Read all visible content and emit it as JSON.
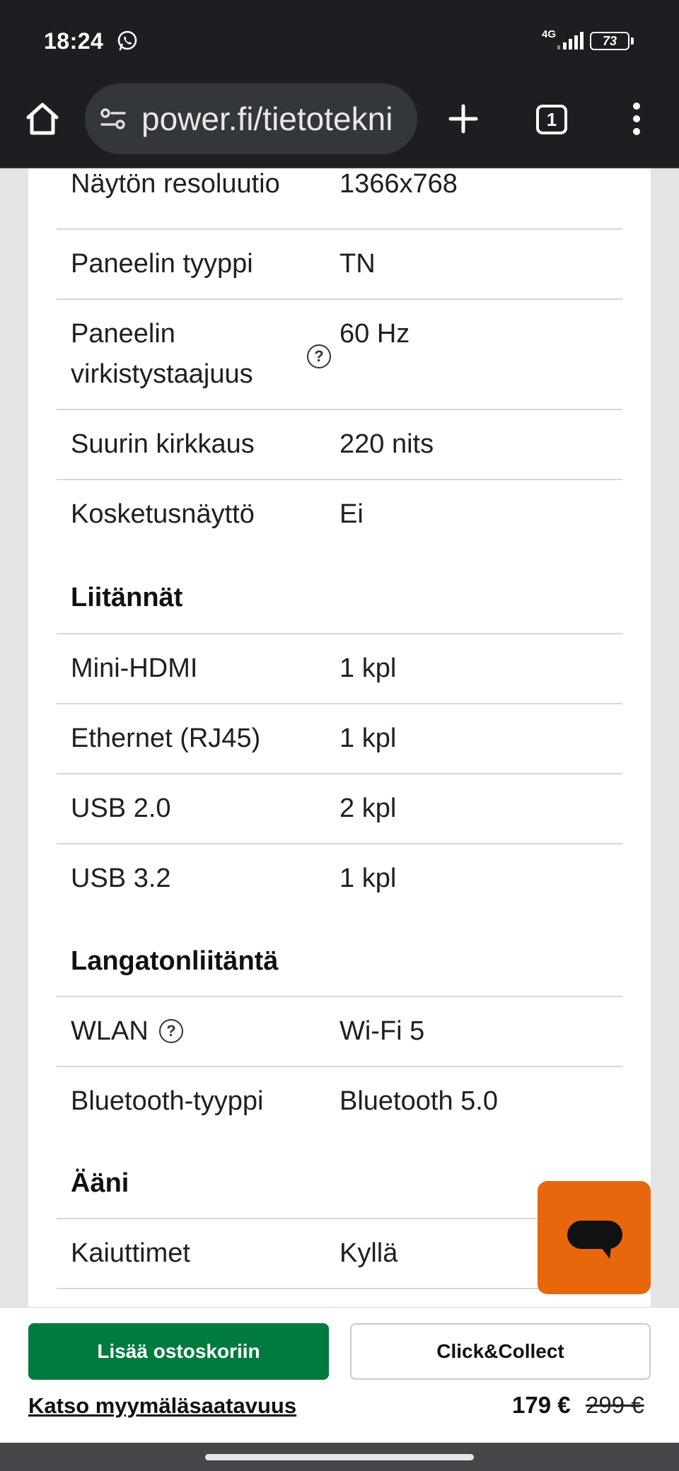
{
  "status_bar": {
    "time": "18:24",
    "network": "4G",
    "battery": "73",
    "icons": [
      "whatsapp-icon",
      "signal-icon",
      "battery-icon"
    ]
  },
  "browser": {
    "url": "power.fi/tietotekni",
    "tab_count": "1",
    "icons": [
      "home-icon",
      "site-settings-icon",
      "new-tab-icon",
      "tab-switcher-icon",
      "overflow-menu-icon"
    ]
  },
  "specs": {
    "display": [
      {
        "label": "Näytön resoluutio",
        "value": "1366x768"
      },
      {
        "label": "Paneelin tyyppi",
        "value": "TN"
      },
      {
        "label_line1": "Paneelin",
        "label_line2": "virkistystaajuus",
        "value": "60 Hz",
        "help": "?"
      },
      {
        "label": "Suurin kirkkaus",
        "value": "220 nits"
      },
      {
        "label": "Kosketusnäyttö",
        "value": "Ei"
      }
    ],
    "connections_heading": "Liitännät",
    "connections": [
      {
        "label": "Mini-HDMI",
        "value": "1 kpl"
      },
      {
        "label": "Ethernet (RJ45)",
        "value": "1 kpl"
      },
      {
        "label": "USB 2.0",
        "value": "2 kpl"
      },
      {
        "label": "USB 3.2",
        "value": "1 kpl"
      }
    ],
    "wireless_heading": "Langatonliitäntä",
    "wireless": [
      {
        "label": "WLAN",
        "value": "Wi-Fi 5",
        "help": "?"
      },
      {
        "label": "Bluetooth-tyyppi",
        "value": "Bluetooth 5.0"
      }
    ],
    "audio_heading": "Ääni",
    "audio": [
      {
        "label": "Kaiuttimet",
        "value": "Kyllä"
      }
    ]
  },
  "chat": {
    "icon": "chat-bubble-icon"
  },
  "purchase": {
    "add_to_cart": "Lisää ostoskoriin",
    "click_collect": "Click&Collect",
    "store_availability": "Katso myymäläsaatavuus",
    "price": "179 €",
    "old_price": "299 €"
  },
  "colors": {
    "cart_button": "#007a3e",
    "chat_button": "#e8660c",
    "browser_chrome": "#1c1e22"
  }
}
